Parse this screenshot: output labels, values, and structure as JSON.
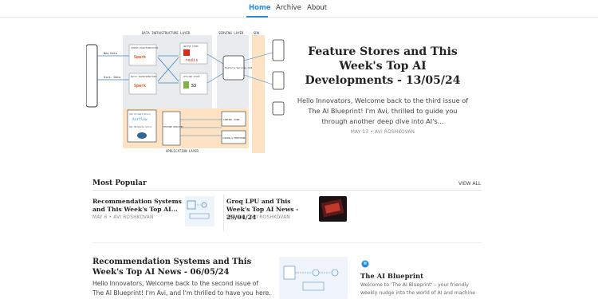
{
  "nav": {
    "tabs": [
      "Home",
      "Archive",
      "About"
    ],
    "active": "Home",
    "accent": "#2b8ad6"
  },
  "hero": {
    "title": "Feature Stores and This Week's Top AI Developments - 13/05/24",
    "subtitle": "Hello Innovators, Welcome back to the third issue of The AI Blueprint! I'm Avi, thrilled to guide you through another deep dive into AI's...",
    "meta": "MAY 13 • AVI ROSHKOVAN",
    "diagram": {
      "data_infra_label": "DATA INFRASTRUCTURE LAYER",
      "serving_label": "SERVING LAYER",
      "sdk_label": "SDK",
      "app_label": "APPLICATION LAYER",
      "stream": "STREAM TRANSFORMATIONS",
      "batch": "BATCH TRANSFORMATIONS",
      "online": "ONLINE STORE",
      "offline": "OFFLINE STORE",
      "redis": "redis",
      "s3": "S3",
      "spark": "Spark",
      "api": "Feature Serving API",
      "airflow": "Airflow",
      "registry": "FEATURE REGISTRY",
      "control": "CONTROL PANE",
      "logging": "LOGGING & MONITORING",
      "new_data": "New Data",
      "hist_data": "Hist. Data",
      "job": "Job Orchestration",
      "sql": "SQL Metadata Store"
    }
  },
  "popular": {
    "heading": "Most Popular",
    "view_all": "VIEW ALL",
    "items": [
      {
        "title": "Recommendation Systems and This Week's Top AI...",
        "meta": "MAY 6 • AVI ROSHKOVAN"
      },
      {
        "title": "Groq LPU and This Week's Top AI News - 29/04/24",
        "meta": "APR 29 • AVI ROSHKOVAN"
      }
    ]
  },
  "latest": {
    "title": "Recommendation Systems and This Week's Top AI News - 06/05/24",
    "subtitle": "Hello Innovators, Welcome back to the second issue of The AI Blueprint! I'm Avi, and I'm thrilled to have you here. This..."
  },
  "sidebar": {
    "title": "The AI Blueprint",
    "description": "Welcome to 'The AI Blueprint' – your friendly weekly nudge into the world of AI and machine"
  },
  "colors": {
    "hero_band_grey": "#e9ecef",
    "hero_band_orange": "#fde3c4",
    "redis": "#d82c20",
    "spark": "#e25a1c"
  }
}
